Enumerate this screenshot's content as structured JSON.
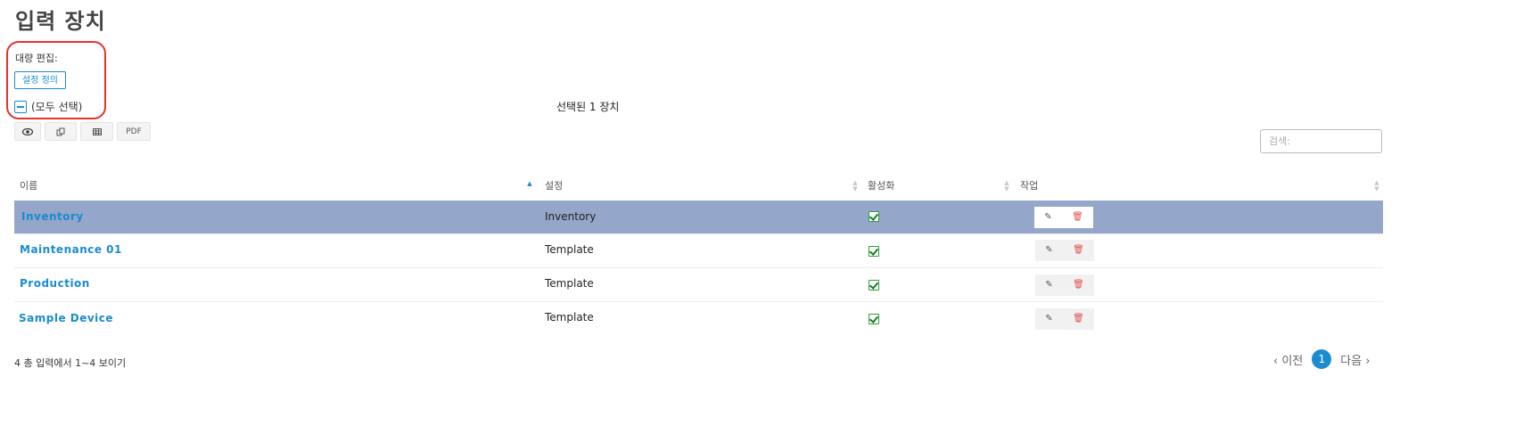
{
  "page": {
    "title": "입력 장치"
  },
  "bulk": {
    "label": "대량 편집:",
    "define_button": "설정 정의"
  },
  "select_all": {
    "label": "(모두 선택)"
  },
  "selection": {
    "text": "선택된 1 장치"
  },
  "toolbar": {
    "pdf_label": "PDF"
  },
  "search": {
    "placeholder": "검색:"
  },
  "table": {
    "headers": {
      "name": "이름",
      "config": "설정",
      "active": "활성화",
      "actions": "작업"
    },
    "rows": [
      {
        "name": "Inventory",
        "config": "Inventory",
        "active": true,
        "selected": true
      },
      {
        "name": "Maintenance 01",
        "config": "Template",
        "active": true,
        "selected": false
      },
      {
        "name": "Production",
        "config": "Template",
        "active": true,
        "selected": false
      },
      {
        "name": "Sample Device",
        "config": "Template",
        "active": true,
        "selected": false
      }
    ]
  },
  "footer": {
    "info": "4 총 입력에서 1~4 보이기"
  },
  "pagination": {
    "prev": "‹ 이전",
    "current": "1",
    "next": "다음 ›"
  },
  "colors": {
    "accent": "#1a8ccf",
    "selected_row": "#94a6c9",
    "highlight_outline": "#e5332a",
    "check": "#2e9e3a",
    "delete": "#e05050"
  },
  "icons": [
    "eye-icon",
    "copy-icon",
    "table-icon",
    "checkbox-checked-icon",
    "edit-icon",
    "trash-icon",
    "sort-icon"
  ]
}
